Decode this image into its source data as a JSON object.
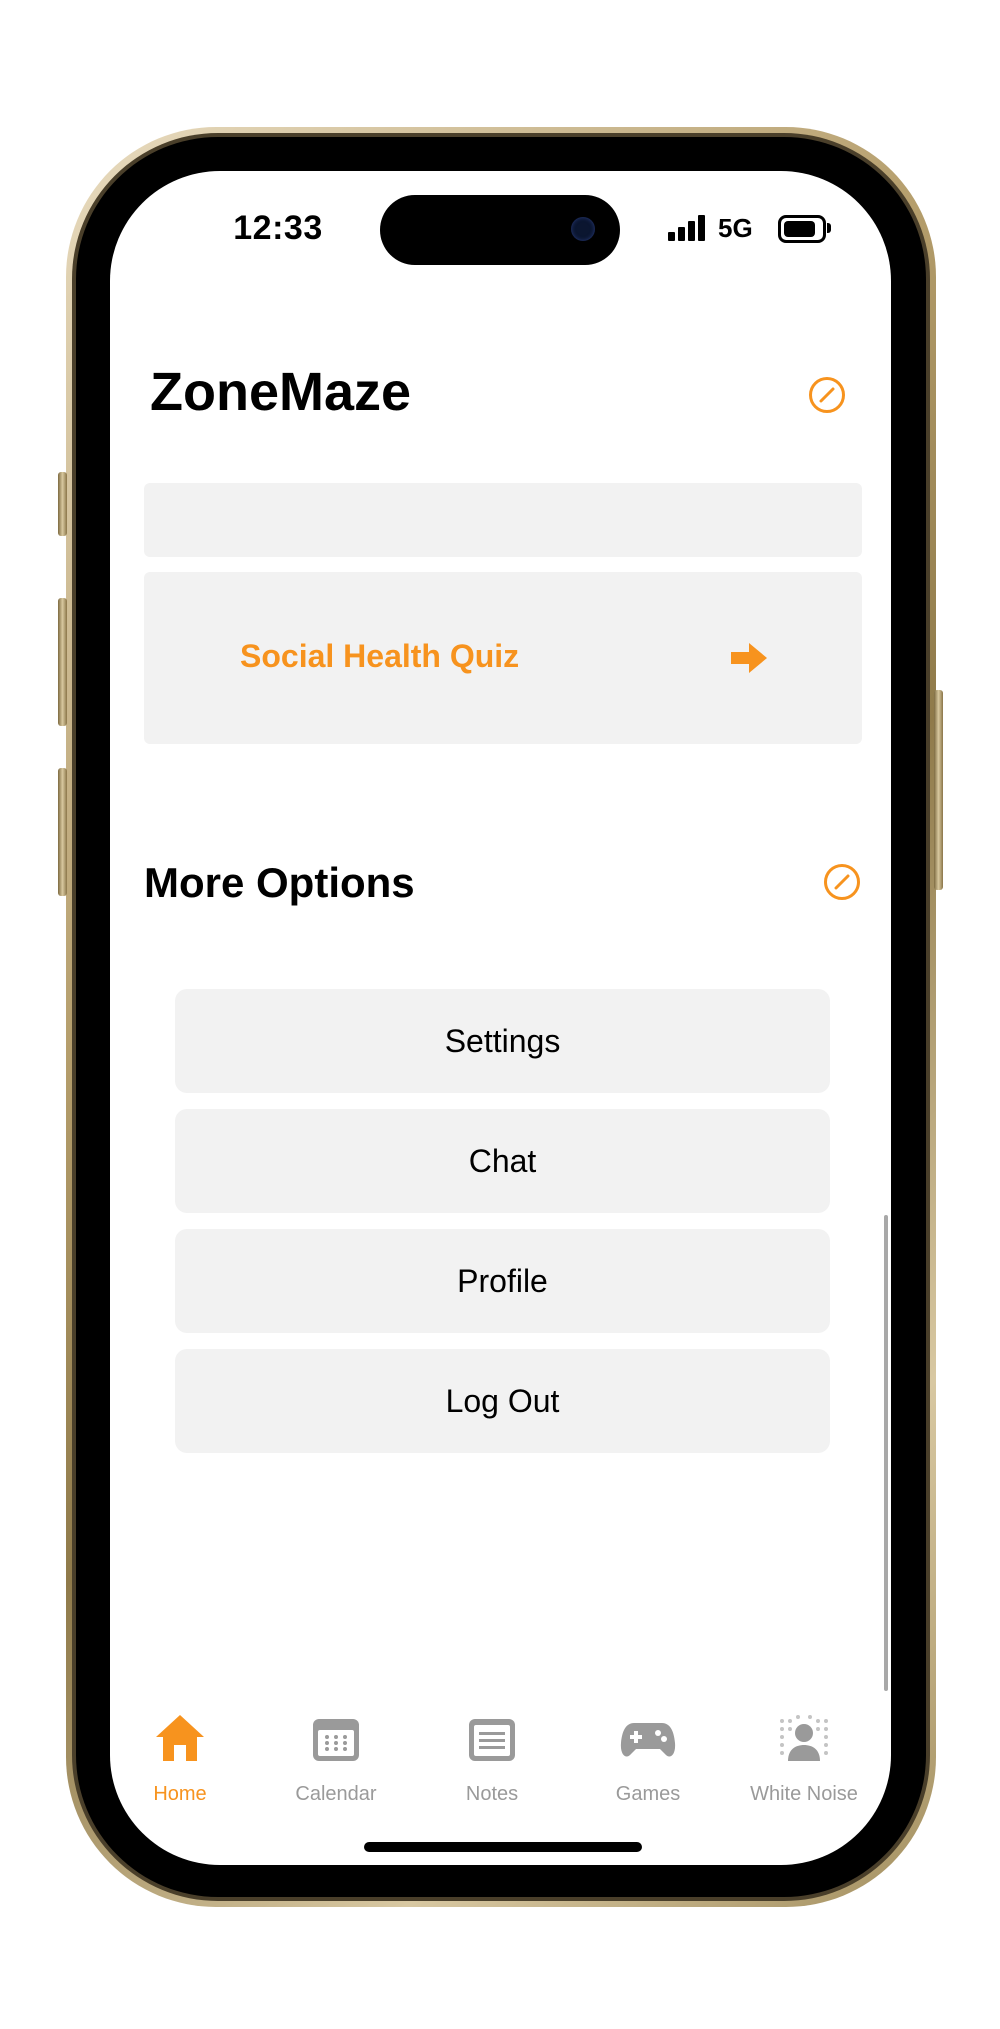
{
  "status": {
    "time": "12:33",
    "network": "5G"
  },
  "header": {
    "title": "ZoneMaze"
  },
  "quiz": {
    "label": "Social Health Quiz"
  },
  "more": {
    "title": "More Options",
    "options": [
      "Settings",
      "Chat",
      "Profile",
      "Log Out"
    ]
  },
  "tabs": [
    {
      "label": "Home",
      "icon": "home-icon",
      "active": true
    },
    {
      "label": "Calendar",
      "icon": "calendar-icon",
      "active": false
    },
    {
      "label": "Notes",
      "icon": "notes-icon",
      "active": false
    },
    {
      "label": "Games",
      "icon": "gamepad-icon",
      "active": false
    },
    {
      "label": "White Noise",
      "icon": "white-noise-icon",
      "active": false
    }
  ],
  "colors": {
    "accent": "#f7931e",
    "inactive": "#9a9a9a",
    "card": "#f2f2f2"
  }
}
